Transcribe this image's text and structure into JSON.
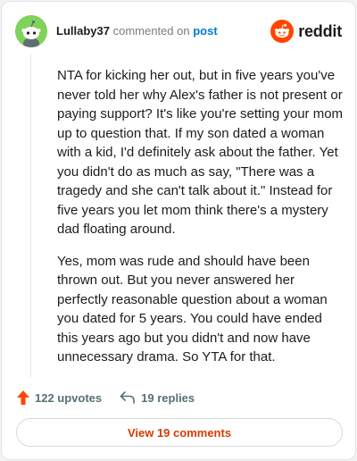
{
  "comment": {
    "username": "Lullaby37",
    "commented_text": "commented on",
    "post_link": "post",
    "paragraphs": [
      "NTA for kicking her out, but in five years you've never told her why Alex's father is not present or paying support? It's like you're setting your mom up to question that. If my son dated a woman with a kid, I'd definitely ask about the father. Yet you didn't do as much as say, \"There was a tragedy and she can't talk about it.\" Instead for five years you let mom think there's a mystery dad floating around.",
      "Yes, mom was rude and should have been thrown out. But you never answered her perfectly reasonable question about a woman you dated for 5 years. You could have ended this years ago but you didn't and now have unnecessary drama. So YTA for that."
    ]
  },
  "brand": {
    "wordmark": "reddit",
    "icon": "reddit-snoo-icon",
    "color": "#ff4500"
  },
  "actions": {
    "upvotes_label": "122 upvotes",
    "replies_label": "19 replies",
    "upvote_icon": "upvote-arrow-icon",
    "reply_icon": "reply-arrow-icon"
  },
  "footer": {
    "view_comments_label": "View 19 comments"
  },
  "colors": {
    "avatar_bg": "#7fd35a",
    "link": "#0079d3",
    "accent": "#d93a00",
    "upvote": "#ff4500",
    "muted": "#576f76"
  }
}
